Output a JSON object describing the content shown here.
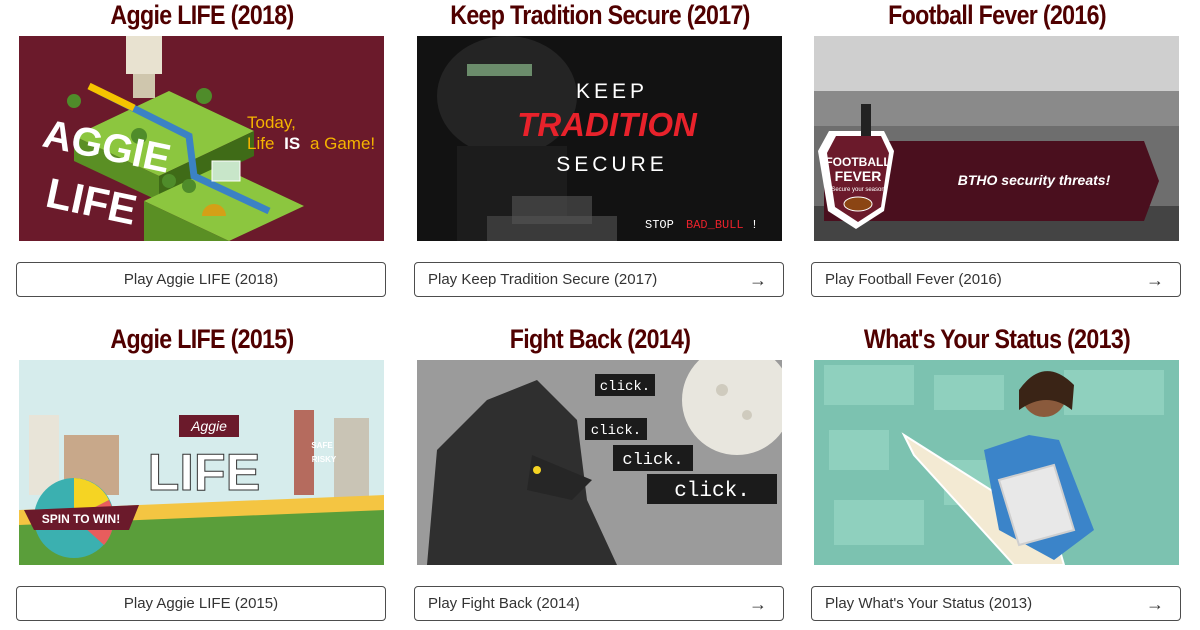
{
  "games": [
    {
      "title": "Aggie LIFE (2018)",
      "button": "Play Aggie LIFE (2018)",
      "art_text": [
        "AGGIE",
        "LIFE",
        "Today,",
        "Life",
        "IS",
        "a Game!"
      ]
    },
    {
      "title": "Keep Tradition Secure (2017)",
      "button": "Play Keep Tradition Secure (2017)",
      "art_text": [
        "KEEP",
        "TRADITION",
        "SECURE",
        "STOP",
        "BAD_BULL",
        "!"
      ]
    },
    {
      "title": "Football Fever (2016)",
      "button": "Play Football Fever (2016)",
      "art_text": [
        "FOOTBALL",
        "FEVER",
        "Secure your season",
        "BTHO security threats!"
      ]
    },
    {
      "title": "Aggie LIFE (2015)",
      "button": "Play Aggie LIFE (2015)",
      "art_text": [
        "Aggie",
        "LIFE",
        "SPIN TO WIN!",
        "SAFE",
        "RISKY"
      ]
    },
    {
      "title": "Fight Back (2014)",
      "button": "Play Fight Back (2014)",
      "art_text": [
        "click.",
        "click.",
        "click.",
        "click."
      ]
    },
    {
      "title": "What's Your Status (2013)",
      "button": "Play What's Your Status (2013)",
      "art_text": []
    }
  ],
  "arrow_icon": "arrow-right-icon",
  "colors": {
    "maroon": "#500000",
    "border": "#4d4d4d"
  }
}
